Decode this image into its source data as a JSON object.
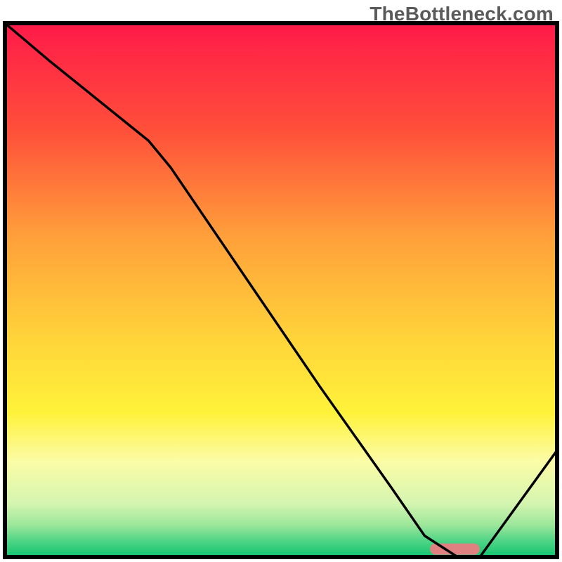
{
  "watermark": {
    "text": "TheBottleneck.com"
  },
  "chart_data": {
    "type": "line",
    "title": "",
    "subtitle": "",
    "xlabel": "",
    "ylabel": "",
    "xlim": [
      0,
      100
    ],
    "ylim": [
      0,
      100
    ],
    "grid": false,
    "legend": false,
    "annotations": [],
    "background_gradient_stops": [
      {
        "pct": 0,
        "color": "#ff1a49"
      },
      {
        "pct": 20,
        "color": "#ff4f3a"
      },
      {
        "pct": 40,
        "color": "#ffa03a"
      },
      {
        "pct": 60,
        "color": "#ffd63a"
      },
      {
        "pct": 73,
        "color": "#fff23a"
      },
      {
        "pct": 82,
        "color": "#fbfca6"
      },
      {
        "pct": 90,
        "color": "#d4f5b0"
      },
      {
        "pct": 94,
        "color": "#9be69a"
      },
      {
        "pct": 97,
        "color": "#4fd486"
      },
      {
        "pct": 100,
        "color": "#10c46f"
      }
    ],
    "series": [
      {
        "name": "bottleneck-curve",
        "x": [
          0,
          8,
          26,
          30,
          57,
          70,
          76,
          82,
          86,
          100
        ],
        "values": [
          100,
          93,
          78,
          73,
          32,
          13,
          4,
          0,
          0,
          20
        ]
      }
    ],
    "marker": {
      "name": "optimal-pill",
      "x_start": 77,
      "x_end": 86,
      "y": 1.5,
      "color": "#e08080"
    },
    "baseline": {
      "y": 0,
      "color": "#000000"
    },
    "border_color": "#000000",
    "border_width": 6
  }
}
